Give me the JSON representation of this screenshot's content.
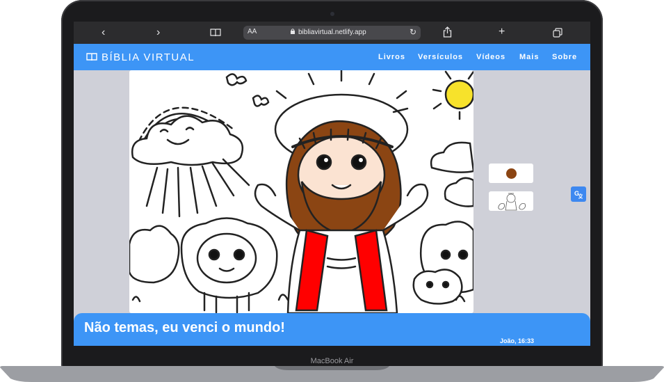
{
  "device": {
    "label": "MacBook Air"
  },
  "browser": {
    "url": "bibliavirtual.netlify.app",
    "text_size_label": "AA",
    "back_icon": "chevron-left-icon",
    "forward_icon": "chevron-right-icon",
    "reader_icon": "book-icon",
    "share_icon": "share-icon",
    "new_tab_icon": "plus-icon",
    "tabs_icon": "tabs-icon",
    "reload_icon": "reload-icon"
  },
  "site": {
    "brand": "BÍBLIA VIRTUAL",
    "brand_icon": "open-book-icon",
    "nav": [
      "Livros",
      "Versículos",
      "Vídeos",
      "Mais",
      "Sobre"
    ],
    "accent_color": "#3d95f6"
  },
  "verse": {
    "text": "Não temas, eu venci o mundo!",
    "reference": "João, 16:33"
  },
  "color_swatch": "#8b4513"
}
